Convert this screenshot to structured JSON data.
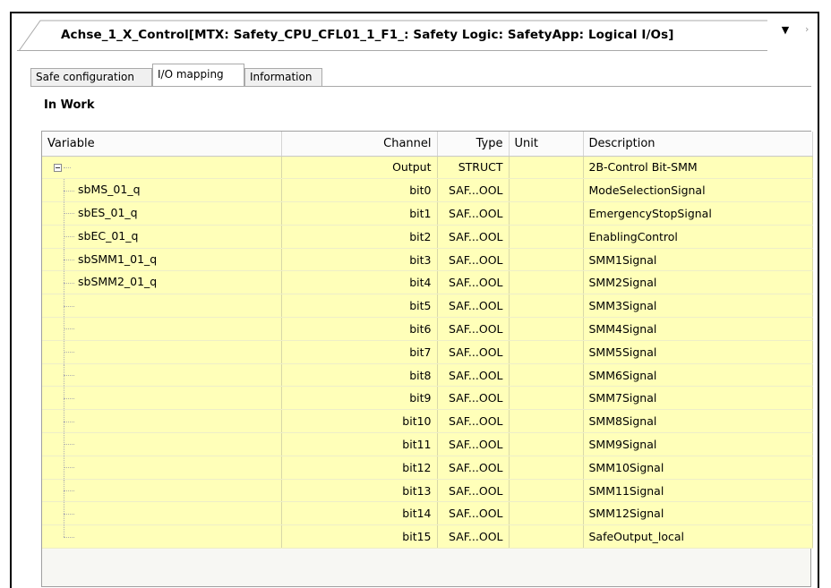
{
  "editor": {
    "title": "Achse_1_X_Control[MTX: Safety_CPU_CFL01_1_F1_: Safety Logic: SafetyApp: Logical I/Os]"
  },
  "subtabs": [
    {
      "label": "Safe configuration",
      "active": false
    },
    {
      "label": "I/O mapping",
      "active": true
    },
    {
      "label": "Information",
      "active": false
    }
  ],
  "status": "In Work",
  "columns": {
    "variable": "Variable",
    "channel": "Channel",
    "type": "Type",
    "unit": "Unit",
    "description": "Description"
  },
  "root_row": {
    "variable": "",
    "channel": "Output",
    "type": "STRUCT",
    "unit": "",
    "description": "2B-Control Bit-SMM"
  },
  "rows": [
    {
      "variable": "sbMS_01_q",
      "channel": "bit0",
      "type": "SAF...OOL",
      "unit": "",
      "description": "ModeSelectionSignal"
    },
    {
      "variable": "sbES_01_q",
      "channel": "bit1",
      "type": "SAF...OOL",
      "unit": "",
      "description": "EmergencyStopSignal"
    },
    {
      "variable": "sbEC_01_q",
      "channel": "bit2",
      "type": "SAF...OOL",
      "unit": "",
      "description": "EnablingControl"
    },
    {
      "variable": "sbSMM1_01_q",
      "channel": "bit3",
      "type": "SAF...OOL",
      "unit": "",
      "description": "SMM1Signal"
    },
    {
      "variable": "sbSMM2_01_q",
      "channel": "bit4",
      "type": "SAF...OOL",
      "unit": "",
      "description": "SMM2Signal"
    },
    {
      "variable": "",
      "channel": "bit5",
      "type": "SAF...OOL",
      "unit": "",
      "description": "SMM3Signal"
    },
    {
      "variable": "",
      "channel": "bit6",
      "type": "SAF...OOL",
      "unit": "",
      "description": "SMM4Signal"
    },
    {
      "variable": "",
      "channel": "bit7",
      "type": "SAF...OOL",
      "unit": "",
      "description": "SMM5Signal"
    },
    {
      "variable": "",
      "channel": "bit8",
      "type": "SAF...OOL",
      "unit": "",
      "description": "SMM6Signal"
    },
    {
      "variable": "",
      "channel": "bit9",
      "type": "SAF...OOL",
      "unit": "",
      "description": "SMM7Signal"
    },
    {
      "variable": "",
      "channel": "bit10",
      "type": "SAF...OOL",
      "unit": "",
      "description": "SMM8Signal"
    },
    {
      "variable": "",
      "channel": "bit11",
      "type": "SAF...OOL",
      "unit": "",
      "description": "SMM9Signal"
    },
    {
      "variable": "",
      "channel": "bit12",
      "type": "SAF...OOL",
      "unit": "",
      "description": "SMM10Signal"
    },
    {
      "variable": "",
      "channel": "bit13",
      "type": "SAF...OOL",
      "unit": "",
      "description": "SMM11Signal"
    },
    {
      "variable": "",
      "channel": "bit14",
      "type": "SAF...OOL",
      "unit": "",
      "description": "SMM12Signal"
    },
    {
      "variable": "",
      "channel": "bit15",
      "type": "SAF...OOL",
      "unit": "",
      "description": "SafeOutput_local"
    }
  ],
  "icons": {
    "collapse": "minus-box-icon",
    "dropdown": "triangle-down-icon",
    "close": "close-icon"
  },
  "colors": {
    "row_background": "#ffffb9",
    "header_background": "#fbfbfb"
  }
}
